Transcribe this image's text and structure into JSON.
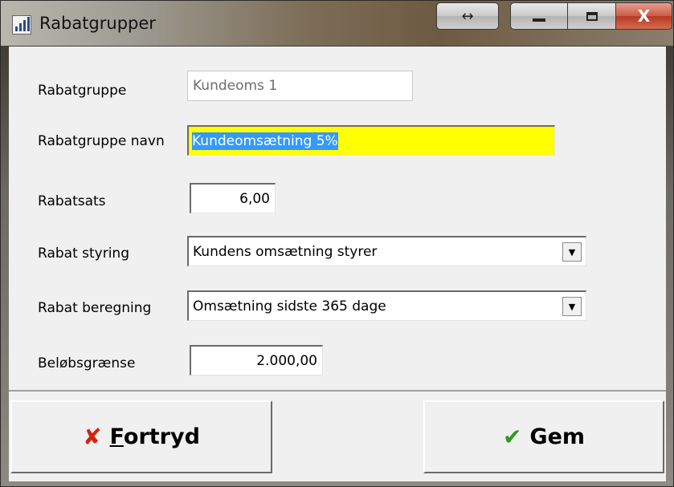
{
  "window": {
    "title": "Rabatgrupper",
    "resize_icon": "↔",
    "close_icon": "X"
  },
  "form": {
    "rabatgruppe": {
      "label": "Rabatgruppe",
      "value": "Kundeoms 1"
    },
    "navn": {
      "label": "Rabatgruppe navn",
      "value": "Kundeomsætning 5%"
    },
    "rabatsats": {
      "label": "Rabatsats",
      "value": "6,00"
    },
    "styring": {
      "label": "Rabat styring",
      "value": "Kundens omsætning styrer"
    },
    "beregning": {
      "label": "Rabat beregning",
      "value": "Omsætning sidste 365 dage"
    },
    "graense": {
      "label": "Beløbsgrænse",
      "value": "2.000,00"
    }
  },
  "buttons": {
    "cancel": {
      "mnemonic": "F",
      "rest": "ortryd",
      "icon": "✘"
    },
    "save": {
      "label": "Gem",
      "icon": "✔"
    }
  }
}
